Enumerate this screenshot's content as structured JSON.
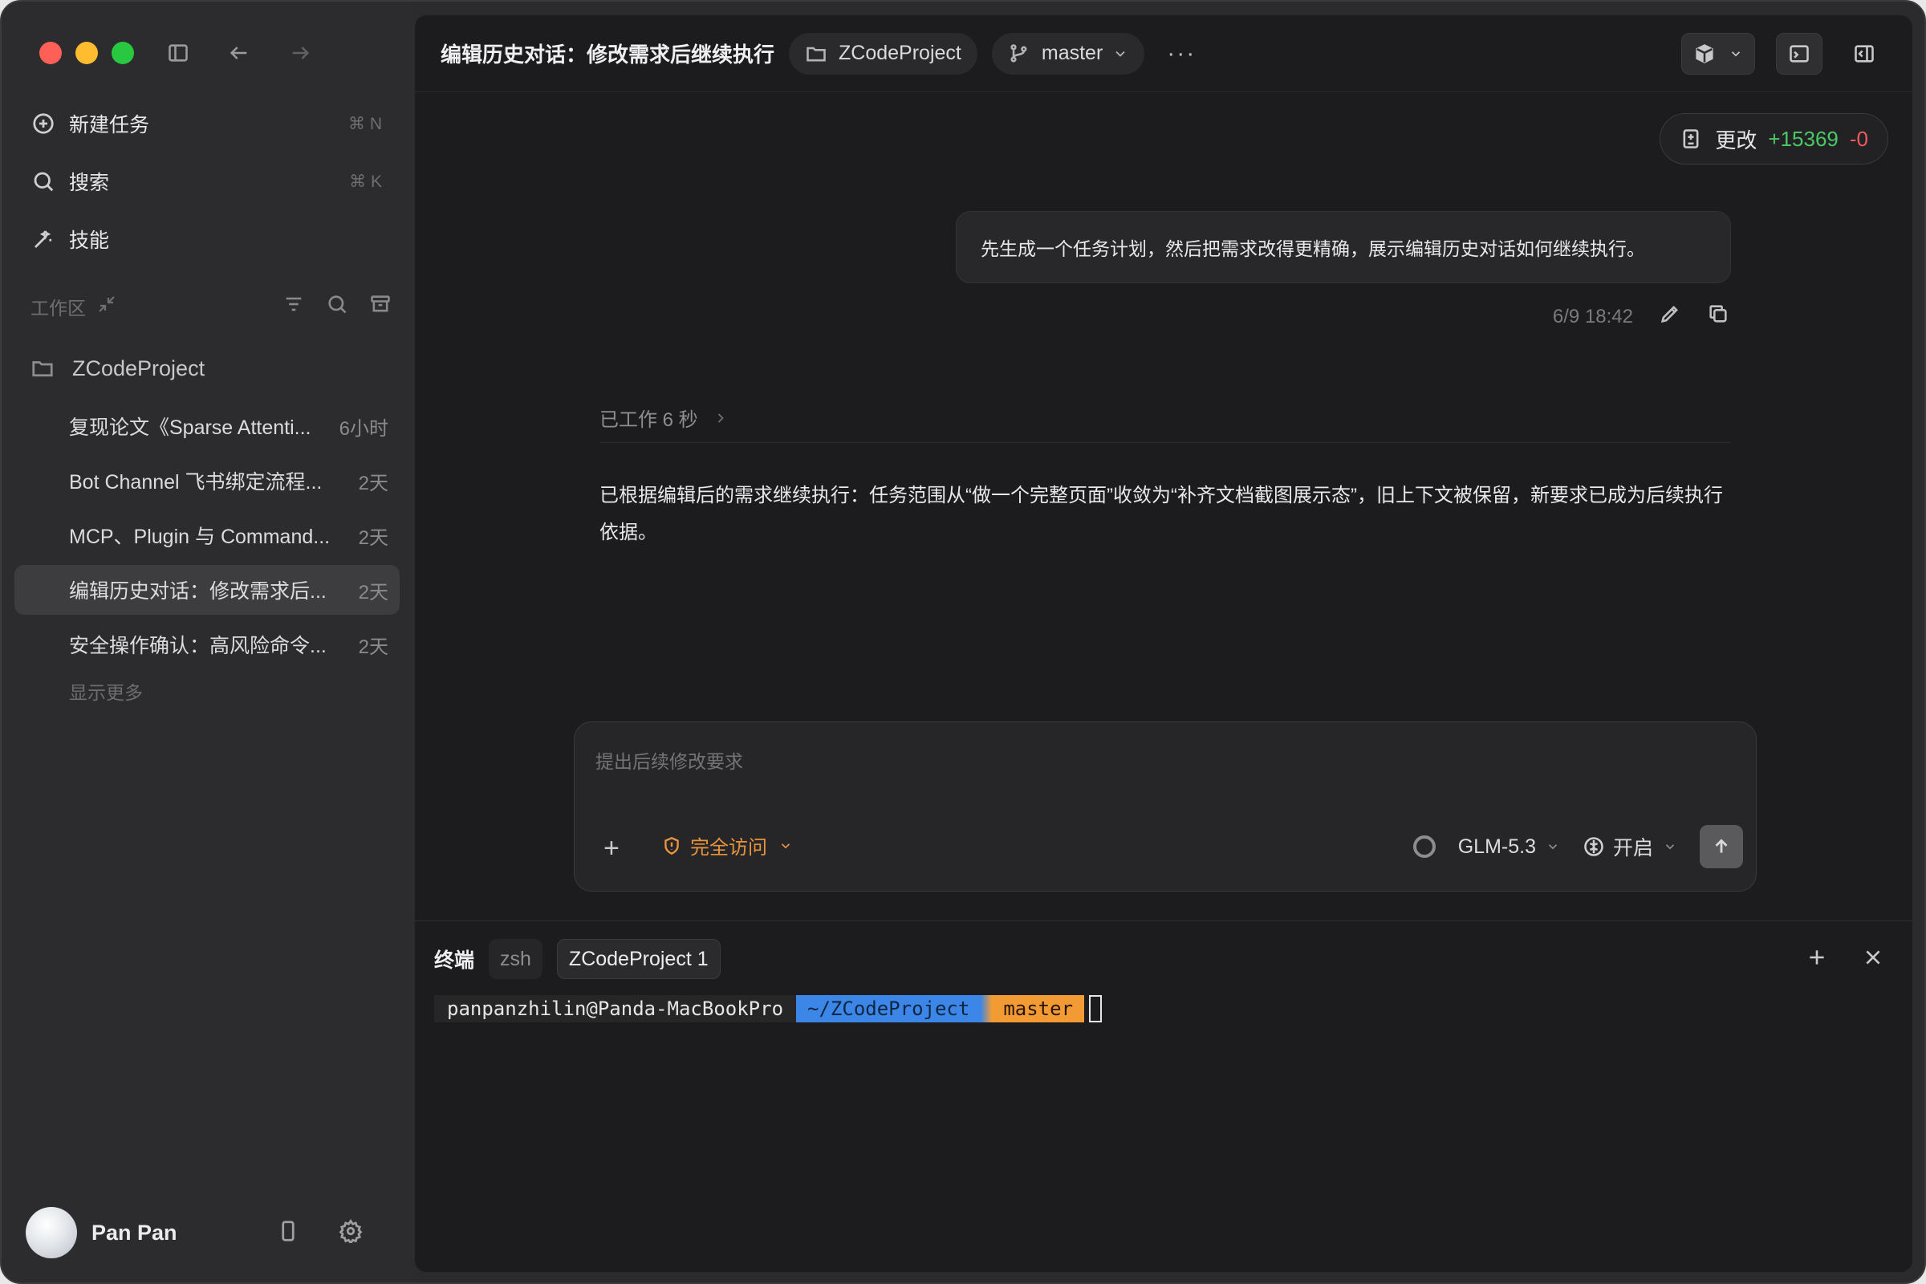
{
  "sidebar": {
    "nav": [
      {
        "label": "新建任务",
        "shortcut": "⌘ N"
      },
      {
        "label": "搜索",
        "shortcut": "⌘ K"
      },
      {
        "label": "技能",
        "shortcut": ""
      }
    ],
    "workspace_label": "工作区",
    "project": "ZCodeProject",
    "tasks": [
      {
        "title": "复现论文《Sparse Attenti...",
        "time": "6小时"
      },
      {
        "title": "Bot Channel 飞书绑定流程...",
        "time": "2天"
      },
      {
        "title": "MCP、Plugin 与 Command...",
        "time": "2天"
      },
      {
        "title": "编辑历史对话：修改需求后...",
        "time": "2天"
      },
      {
        "title": "安全操作确认：高风险命令...",
        "time": "2天"
      }
    ],
    "show_more": "显示更多",
    "user": {
      "name": "Pan Pan"
    }
  },
  "header": {
    "title": "编辑历史对话：修改需求后继续执行",
    "project": "ZCodeProject",
    "branch": "master",
    "more": "···"
  },
  "changes": {
    "label": "更改",
    "added": "+15369",
    "removed": "-0"
  },
  "conversation": {
    "user_message": "先生成一个任务计划，然后把需求改得更精确，展示编辑历史对话如何继续执行。",
    "timestamp": "6/9 18:42",
    "worked": "已工作 6 秒",
    "answer": "已根据编辑后的需求继续执行：任务范围从“做一个完整页面”收敛为“补齐文档截图展示态”，旧上下文被保留，新要求已成为后续执行依据。"
  },
  "composer": {
    "placeholder": "提出后续修改要求",
    "access": "完全访问",
    "model": "GLM-5.3",
    "thinking": "开启"
  },
  "terminal": {
    "label": "终端",
    "tabs": [
      "zsh",
      "ZCodeProject 1"
    ],
    "prompt_user": "panpanzhilin@Panda-MacBookPro",
    "prompt_path": " ~/ZCodeProject ",
    "prompt_branch": " master "
  },
  "colors": {
    "accent_orange": "#e8943d",
    "added_green": "#4cc766",
    "removed_red": "#ef5a5a",
    "path_blue": "#3b86e6",
    "branch_orange": "#f29b35"
  }
}
